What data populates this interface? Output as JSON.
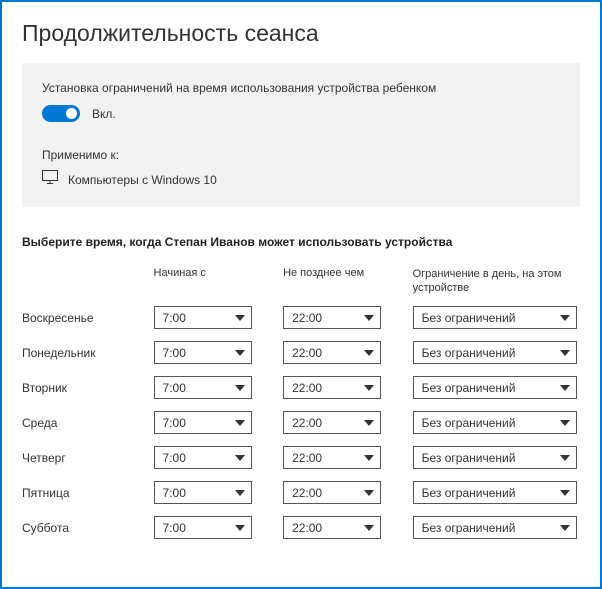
{
  "title": "Продолжительность сеанса",
  "card": {
    "settingLabel": "Установка ограничений на время использования устройства ребенком",
    "toggleState": "Вкл.",
    "appliesLabel": "Применимо к:",
    "deviceText": "Компьютеры с Windows 10"
  },
  "scheduleHeading": "Выберите время, когда Степан Иванов может использовать устройства",
  "columns": {
    "start": "Начиная с",
    "end": "Не позднее чем",
    "limit": "Ограничение в день, на этом устройстве"
  },
  "days": [
    {
      "name": "Воскресенье",
      "start": "7:00",
      "end": "22:00",
      "limit": "Без ограничений"
    },
    {
      "name": "Понедельник",
      "start": "7:00",
      "end": "22:00",
      "limit": "Без ограничений"
    },
    {
      "name": "Вторник",
      "start": "7:00",
      "end": "22:00",
      "limit": "Без ограничений"
    },
    {
      "name": "Среда",
      "start": "7:00",
      "end": "22:00",
      "limit": "Без ограничений"
    },
    {
      "name": "Четверг",
      "start": "7:00",
      "end": "22:00",
      "limit": "Без ограничений"
    },
    {
      "name": "Пятница",
      "start": "7:00",
      "end": "22:00",
      "limit": "Без ограничений"
    },
    {
      "name": "Суббота",
      "start": "7:00",
      "end": "22:00",
      "limit": "Без ограничений"
    }
  ]
}
